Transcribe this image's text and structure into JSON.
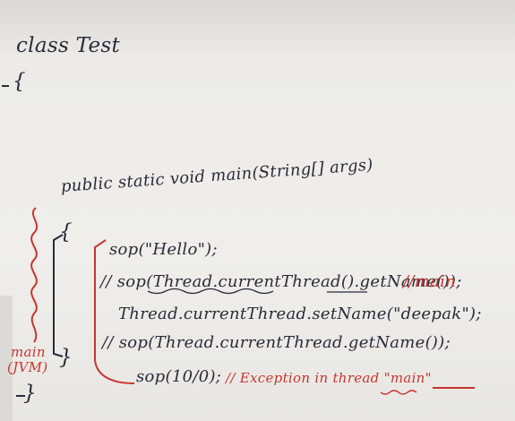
{
  "board": {
    "class_line": "class Test",
    "class_open_brace": "{",
    "class_close_brace": "}",
    "method_signature": "public static void main(String[] args)",
    "method_open_brace": "{",
    "method_close_brace": "}",
    "statements": [
      {
        "code": "sop(\"Hello\");",
        "comment": ""
      },
      {
        "code": "// sop(Thread.currentThread().getName());",
        "comment": "//main"
      },
      {
        "code": "Thread.currentThread.setName(\"deepak\");",
        "comment": ""
      },
      {
        "code": "// sop(Thread.currentThread.getName());",
        "comment": ""
      },
      {
        "code": "sop(10/0);",
        "comment": "// Exception in thread \"main\""
      }
    ],
    "side_note_line1": "main",
    "side_note_line2": "(JVM)",
    "colors": {
      "ink": "#2b2a3a",
      "marker_red": "#c8352f",
      "board": "#ecebe7"
    }
  }
}
